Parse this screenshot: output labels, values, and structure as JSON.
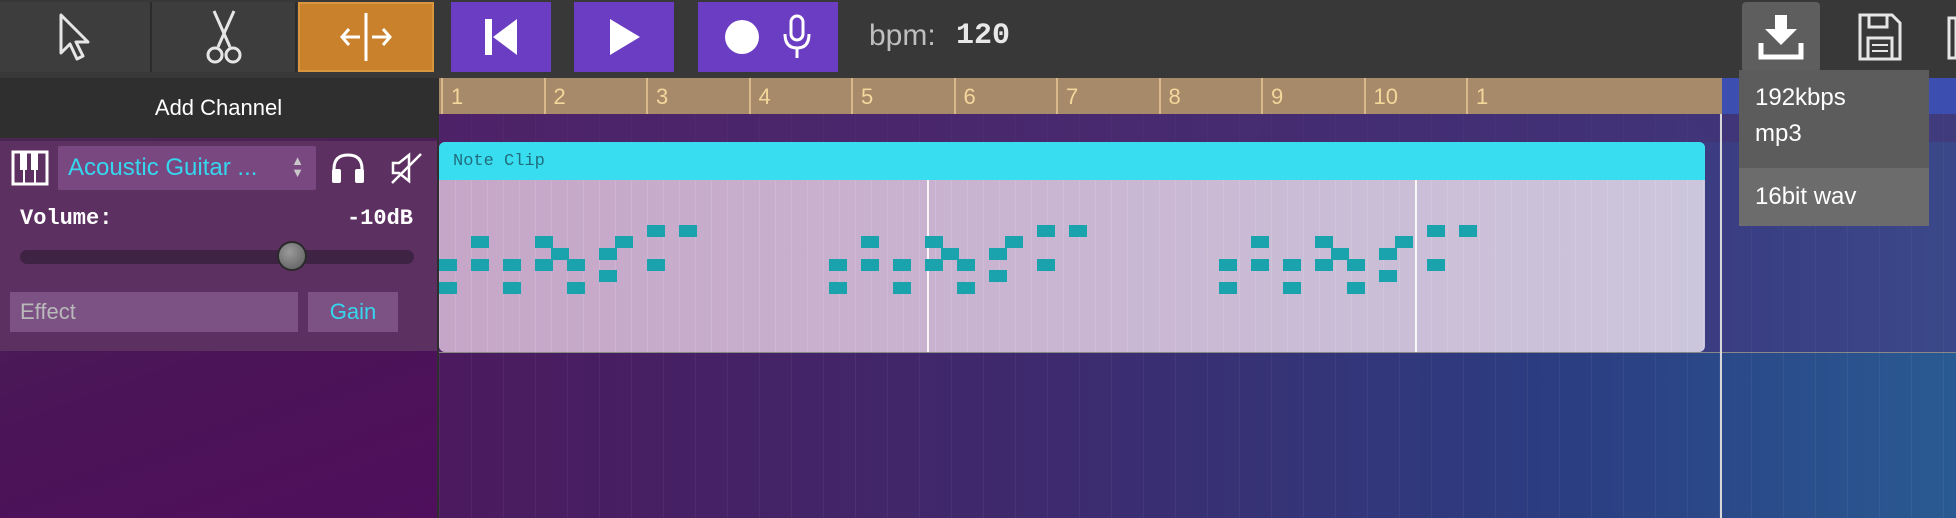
{
  "toolbar": {
    "tools": [
      {
        "name": "select-tool",
        "icon": "cursor-icon"
      },
      {
        "name": "cut-tool",
        "icon": "scissors-icon"
      },
      {
        "name": "split-tool",
        "icon": "split-icon",
        "active": true
      }
    ],
    "transport": [
      {
        "name": "skip-back-button",
        "icon": "skip-back-icon"
      },
      {
        "name": "play-button",
        "icon": "play-icon"
      },
      {
        "name": "record-button",
        "icon": "record-icon"
      },
      {
        "name": "microphone-button",
        "icon": "microphone-icon"
      }
    ],
    "bpm_label": "bpm:",
    "bpm_value": "120",
    "right_icons": [
      "download-icon",
      "save-icon",
      "trash-icon"
    ]
  },
  "channels": {
    "add_label": "Add Channel",
    "items": [
      {
        "instrument": "Acoustic Guitar ...",
        "icons": [
          "piano-icon",
          "headphones-icon",
          "mute-icon"
        ],
        "volume_label": "Volume:",
        "volume_value": "-10dB",
        "volume_fraction": 0.69,
        "effect_placeholder": "Effect",
        "effect_value": "",
        "gain_label": "Gain"
      }
    ]
  },
  "timeline": {
    "bars": [
      "1",
      "2",
      "3",
      "4",
      "5",
      "6",
      "7",
      "8",
      "9",
      "10",
      "1"
    ],
    "clip_title": "Note Clip"
  },
  "export_menu": {
    "items": [
      "192kbps mp3",
      "16bit wav"
    ]
  },
  "colors": {
    "accent_cyan": "#38def0",
    "active_tool": "#c9822b",
    "transport_purple": "#6a3dc2",
    "note": "#1aa3ad",
    "ruler": "#a68a6a"
  }
}
